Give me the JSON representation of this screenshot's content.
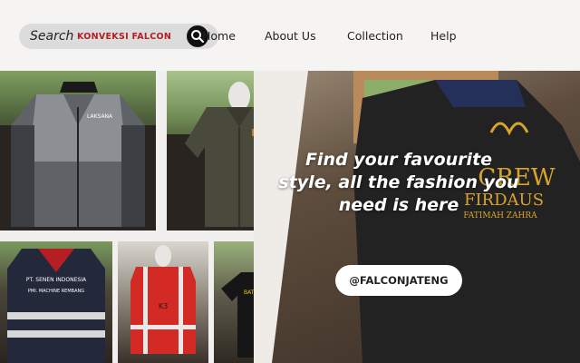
{
  "header": {
    "search": {
      "label": "Search",
      "brand": "KONVEKSI FALCON"
    },
    "nav": [
      {
        "label": "Home"
      },
      {
        "label": "About Us"
      },
      {
        "label": "Collection"
      },
      {
        "label": "Help"
      }
    ]
  },
  "hero": {
    "headline": "Find your favourite style, all the fashion you need is here",
    "social_handle": "@FALCONJATENG"
  },
  "photos": {
    "jacket_label": "LAKSANA",
    "vest_label": "PT. SENEN INDONESIA",
    "vest_sublabel": "PMI. MACHINE REMBANG",
    "safety_vest_label": "K3",
    "tshirt_label": "BATERFLAY VALVE",
    "crew_text": "CREW",
    "crew_name": "FIRDAUS",
    "crew_sub": "FATIMAH ZAHRA"
  },
  "colors": {
    "brand_red": "#b51e22",
    "header_bg": "#f6f4f2",
    "search_bg": "#dcdcdc",
    "gold_embroidery": "#d6a52a"
  }
}
